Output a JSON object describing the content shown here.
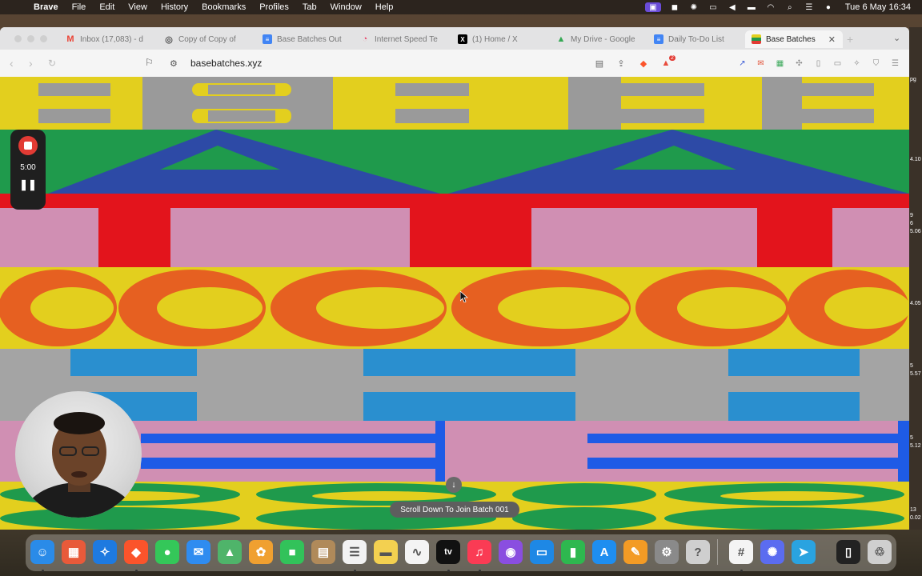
{
  "menubar": {
    "app": "Brave",
    "items": [
      "File",
      "Edit",
      "View",
      "History",
      "Bookmarks",
      "Profiles",
      "Tab",
      "Window",
      "Help"
    ],
    "clock": "Tue 6 May  16:34"
  },
  "tabs": [
    {
      "label": "Inbox (17,083) - d",
      "icon": "gmail-icon",
      "color": "#ea4335"
    },
    {
      "label": "Copy of Copy of",
      "icon": "globe-icon",
      "color": "#777777"
    },
    {
      "label": "Base Batches Out",
      "icon": "docs-icon",
      "color": "#4285f4"
    },
    {
      "label": "Internet Speed Te",
      "icon": "speedtest-icon",
      "color": "#e84c6f"
    },
    {
      "label": "(1) Home / X",
      "icon": "x-icon",
      "color": "#000000"
    },
    {
      "label": "My Drive - Google",
      "icon": "drive-icon",
      "color": "#34a853"
    },
    {
      "label": "Daily To-Do List",
      "icon": "docs-icon",
      "color": "#4285f4"
    },
    {
      "label": "Base Batches",
      "icon": "basebatches-icon",
      "color": "#e23b34",
      "active": true
    }
  ],
  "toolbar": {
    "url": "basebatches.xyz",
    "shield_count": "2"
  },
  "recorder": {
    "time": "5:00"
  },
  "page": {
    "scroll_label": "Scroll Down To Join Batch 001",
    "bands": [
      {
        "letter": "B",
        "bg": "#e3cf1e",
        "fg": "#9a9a9a"
      },
      {
        "letter": "A",
        "bg": "#1f9a4c",
        "fg": "#2d4aa6"
      },
      {
        "letter": "T",
        "bg": "#d08fb3",
        "fg": "#e3141c"
      },
      {
        "letter": "C",
        "bg": "#e3cf1e",
        "fg": "#e66021"
      },
      {
        "letter": "E",
        "bg": "#a4a4a4",
        "fg": "#2a8fcf"
      },
      {
        "letter": "E",
        "bg": "#d08fb3",
        "fg": "#1e5be6"
      },
      {
        "letter": "S",
        "bg": "#e3cf1e",
        "fg": "#1f9a4c"
      }
    ]
  },
  "edge_labels": [
    "pg",
    "4.10",
    "9",
    "6",
    "5.06",
    "4.05",
    "5",
    "5.57",
    "5",
    "5.12",
    "13",
    "0.02"
  ],
  "dock": [
    {
      "name": "finder-icon",
      "color": "#2a8be8",
      "glyph": "☺"
    },
    {
      "name": "launchpad-icon",
      "color": "#e85a3a",
      "glyph": "▦"
    },
    {
      "name": "safari-icon",
      "color": "#1e7ae0",
      "glyph": "✧"
    },
    {
      "name": "brave-icon",
      "color": "#fb542b",
      "glyph": "◆"
    },
    {
      "name": "messages-icon",
      "color": "#34c759",
      "glyph": "●"
    },
    {
      "name": "mail-icon",
      "color": "#2f8cf0",
      "glyph": "✉"
    },
    {
      "name": "maps-icon",
      "color": "#4fb46a",
      "glyph": "▲"
    },
    {
      "name": "photos-icon",
      "color": "#f0a030",
      "glyph": "✿"
    },
    {
      "name": "facetime-icon",
      "color": "#32c25a",
      "glyph": "■"
    },
    {
      "name": "contacts-icon",
      "color": "#b08a5a",
      "glyph": "▤"
    },
    {
      "name": "reminders-icon",
      "color": "#f2f2f2",
      "glyph": "☰"
    },
    {
      "name": "notes-icon",
      "color": "#f3d050",
      "glyph": "▬"
    },
    {
      "name": "freeform-icon",
      "color": "#f4f4f4",
      "glyph": "∿"
    },
    {
      "name": "tv-icon",
      "color": "#111111",
      "glyph": "tv"
    },
    {
      "name": "music-icon",
      "color": "#fa3b54",
      "glyph": "♫"
    },
    {
      "name": "podcasts-icon",
      "color": "#8a4ee0",
      "glyph": "◉"
    },
    {
      "name": "keynote-icon",
      "color": "#1e88e5",
      "glyph": "▭"
    },
    {
      "name": "numbers-icon",
      "color": "#2eb84f",
      "glyph": "▮"
    },
    {
      "name": "appstore-icon",
      "color": "#1e8ef0",
      "glyph": "A"
    },
    {
      "name": "pages-icon",
      "color": "#f39b25",
      "glyph": "✎"
    },
    {
      "name": "settings-icon",
      "color": "#8a8a8a",
      "glyph": "⚙"
    },
    {
      "name": "help-icon",
      "color": "#cfcfcf",
      "glyph": "?"
    },
    {
      "name": "slack-icon",
      "color": "#f4f4f4",
      "glyph": "#"
    },
    {
      "name": "gear-app-icon",
      "color": "#5b6cf0",
      "glyph": "✺"
    },
    {
      "name": "telegram-icon",
      "color": "#2aa3e0",
      "glyph": "➤"
    },
    {
      "name": "phone-mirror-icon",
      "color": "#222222",
      "glyph": "▯"
    },
    {
      "name": "trash-icon",
      "color": "#cfcfcf",
      "glyph": "♲"
    }
  ]
}
